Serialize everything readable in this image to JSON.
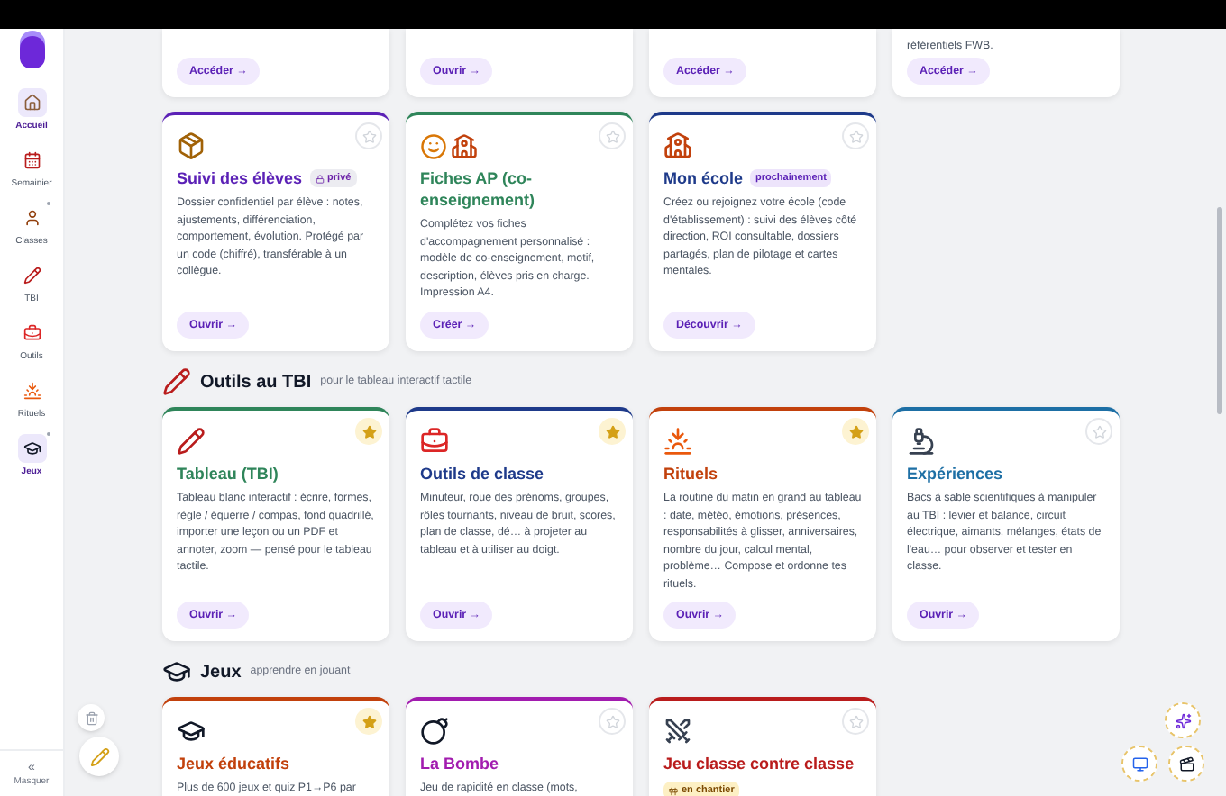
{
  "sidebar": {
    "items": [
      {
        "label": "Accueil",
        "selected": true,
        "dot": false
      },
      {
        "label": "Semainier",
        "selected": false,
        "dot": false
      },
      {
        "label": "Classes",
        "selected": false,
        "dot": true
      },
      {
        "label": "TBI",
        "selected": false,
        "dot": false
      },
      {
        "label": "Outils",
        "selected": false,
        "dot": false
      },
      {
        "label": "Rituels",
        "selected": false,
        "dot": false
      },
      {
        "label": "Jeux",
        "selected": true,
        "dot": true
      }
    ],
    "collapse": {
      "symbol": "«",
      "label": "Masquer"
    }
  },
  "top_cards": [
    {
      "button": "Accéder →"
    },
    {
      "button": "Ouvrir →"
    },
    {
      "button": "Accéder →"
    },
    {
      "text": "référentiels FWB.",
      "button": "Accéder →"
    }
  ],
  "sections": [
    {
      "cards": [
        {
          "title": "Suivi des élèves",
          "color": "#5b21b6",
          "favorite": false,
          "badge": {
            "text": "privé",
            "kind": "private"
          },
          "description": "Dossier confidentiel par élève : notes, ajustements, différenciation, comportement, évolution. Protégé par un code (chiffré), transférable à un collègue.",
          "button": "Ouvrir →"
        },
        {
          "title": "Fiches AP (co-enseignement)",
          "color": "#2f855a",
          "favorite": false,
          "description": "Complétez vos fiches d'accompagnement personnalisé : modèle de co-enseignement, motif, description, élèves pris en charge. Impression A4.",
          "button": "Créer →"
        },
        {
          "title": "Mon école",
          "color": "#1e3a8a",
          "favorite": false,
          "badge": {
            "text": "prochainement",
            "kind": "soon"
          },
          "description": "Créez ou rejoignez votre école (code d'établissement) : suivi des élèves côté direction, ROI consultable, dossiers partagés, plan de pilotage et cartes mentales.",
          "button": "Découvrir →"
        }
      ]
    },
    {
      "title": "Outils au TBI",
      "subtitle": "pour le tableau interactif tactile",
      "cards": [
        {
          "title": "Tableau (TBI)",
          "color": "#2f855a",
          "favorite": true,
          "description": "Tableau blanc interactif : écrire, formes, règle / équerre / compas, fond quadrillé, importer une leçon ou un PDF et annoter, zoom — pensé pour le tableau tactile.",
          "button": "Ouvrir →"
        },
        {
          "title": "Outils de classe",
          "color": "#1e3a8a",
          "favorite": true,
          "description": "Minuteur, roue des prénoms, groupes, rôles tournants, niveau de bruit, scores, plan de classe, dé… à projeter au tableau et à utiliser au doigt.",
          "button": "Ouvrir →"
        },
        {
          "title": "Rituels",
          "color": "#c2410c",
          "favorite": true,
          "description": "La routine du matin en grand au tableau : date, météo, émotions, présences, responsabilités à glisser, anniversaires, nombre du jour, calcul mental, problème… Compose et ordonne tes rituels.",
          "button": "Ouvrir →"
        },
        {
          "title": "Expériences",
          "color": "#1d6fa5",
          "favorite": false,
          "description": "Bacs à sable scientifiques à manipuler au TBI : levier et balance, circuit électrique, aimants, mélanges, états de l'eau… pour observer et tester en classe.",
          "button": "Ouvrir →"
        }
      ]
    },
    {
      "title": "Jeux",
      "subtitle": "apprendre en jouant",
      "cards": [
        {
          "title": "Jeux éducatifs",
          "color": "#c2410c",
          "favorite": true,
          "description": "Plus de 600 jeux et quiz P1→P6 par"
        },
        {
          "title": "La Bombe",
          "color": "#a21caf",
          "favorite": false,
          "description": "Jeu de rapidité en classe (mots,"
        },
        {
          "title": "Jeu classe contre classe",
          "color": "#b91c1c",
          "favorite": false,
          "badge": {
            "text": "en chantier",
            "kind": "wip"
          }
        }
      ]
    }
  ]
}
